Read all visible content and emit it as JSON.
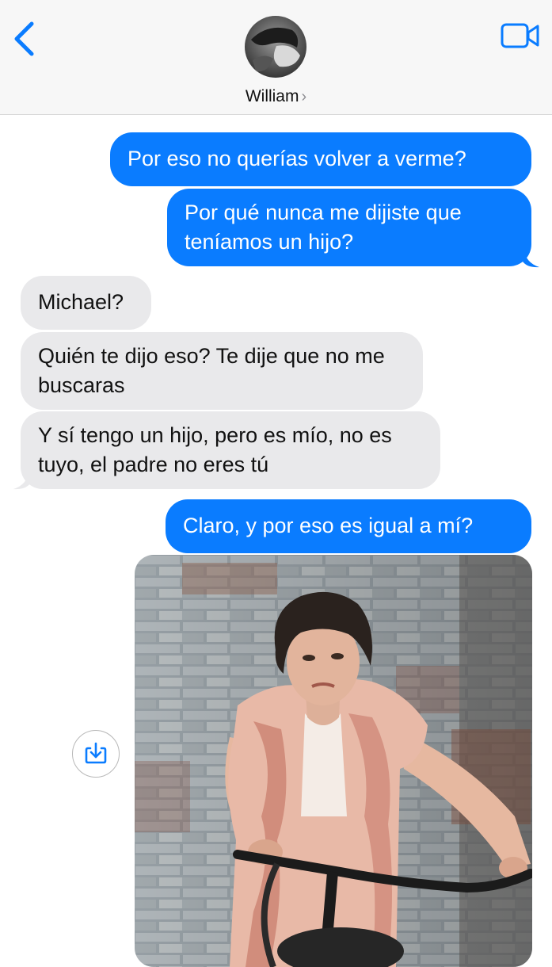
{
  "header": {
    "contact_name": "William",
    "chevron": "›",
    "back_icon": "chevron-left-icon",
    "video_icon": "video-camera-icon"
  },
  "colors": {
    "outgoing": "#0a7cff",
    "incoming": "#e9e9eb",
    "accent": "#0a7cff"
  },
  "messages": [
    {
      "direction": "out",
      "text": "Por eso no querías volver a verme?"
    },
    {
      "direction": "out",
      "text": "Por qué nunca me dijiste que teníamos un hijo?"
    },
    {
      "direction": "in",
      "text": "Michael?"
    },
    {
      "direction": "in",
      "text": "Quién te dijo eso? Te dije que no me buscaras"
    },
    {
      "direction": "in",
      "text": "Y sí tengo un hijo, pero es mío, no es tuyo, el padre no eres tú"
    },
    {
      "direction": "out",
      "text": "Claro, y por eso es igual a mí?"
    },
    {
      "direction": "out",
      "type": "image",
      "icon": "photo-attachment"
    }
  ],
  "attachment": {
    "save_icon": "download-icon"
  }
}
